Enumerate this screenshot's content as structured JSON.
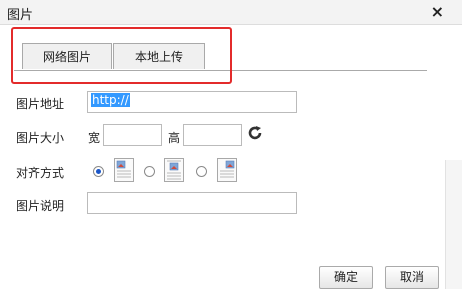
{
  "dialog": {
    "title": "图片",
    "close_glyph": "×"
  },
  "tabs": [
    {
      "label": "网络图片"
    },
    {
      "label": "本地上传"
    }
  ],
  "form": {
    "url_label": "图片地址",
    "url_value": "http://",
    "size_label": "图片大小",
    "width_label": "宽",
    "height_label": "高",
    "width_value": "",
    "height_value": "",
    "refresh_icon": "refresh-icon",
    "align_label": "对齐方式",
    "align_options": [
      {
        "icon": "align-left-icon",
        "selected": true
      },
      {
        "icon": "align-none-icon",
        "selected": false
      },
      {
        "icon": "align-right-icon",
        "selected": false
      }
    ],
    "desc_label": "图片说明",
    "desc_value": ""
  },
  "buttons": {
    "ok": "确定",
    "cancel": "取消"
  },
  "colors": {
    "highlight_border": "#e32b2b",
    "selection": "#3399ff",
    "radio_selected": "#1a56c8"
  }
}
